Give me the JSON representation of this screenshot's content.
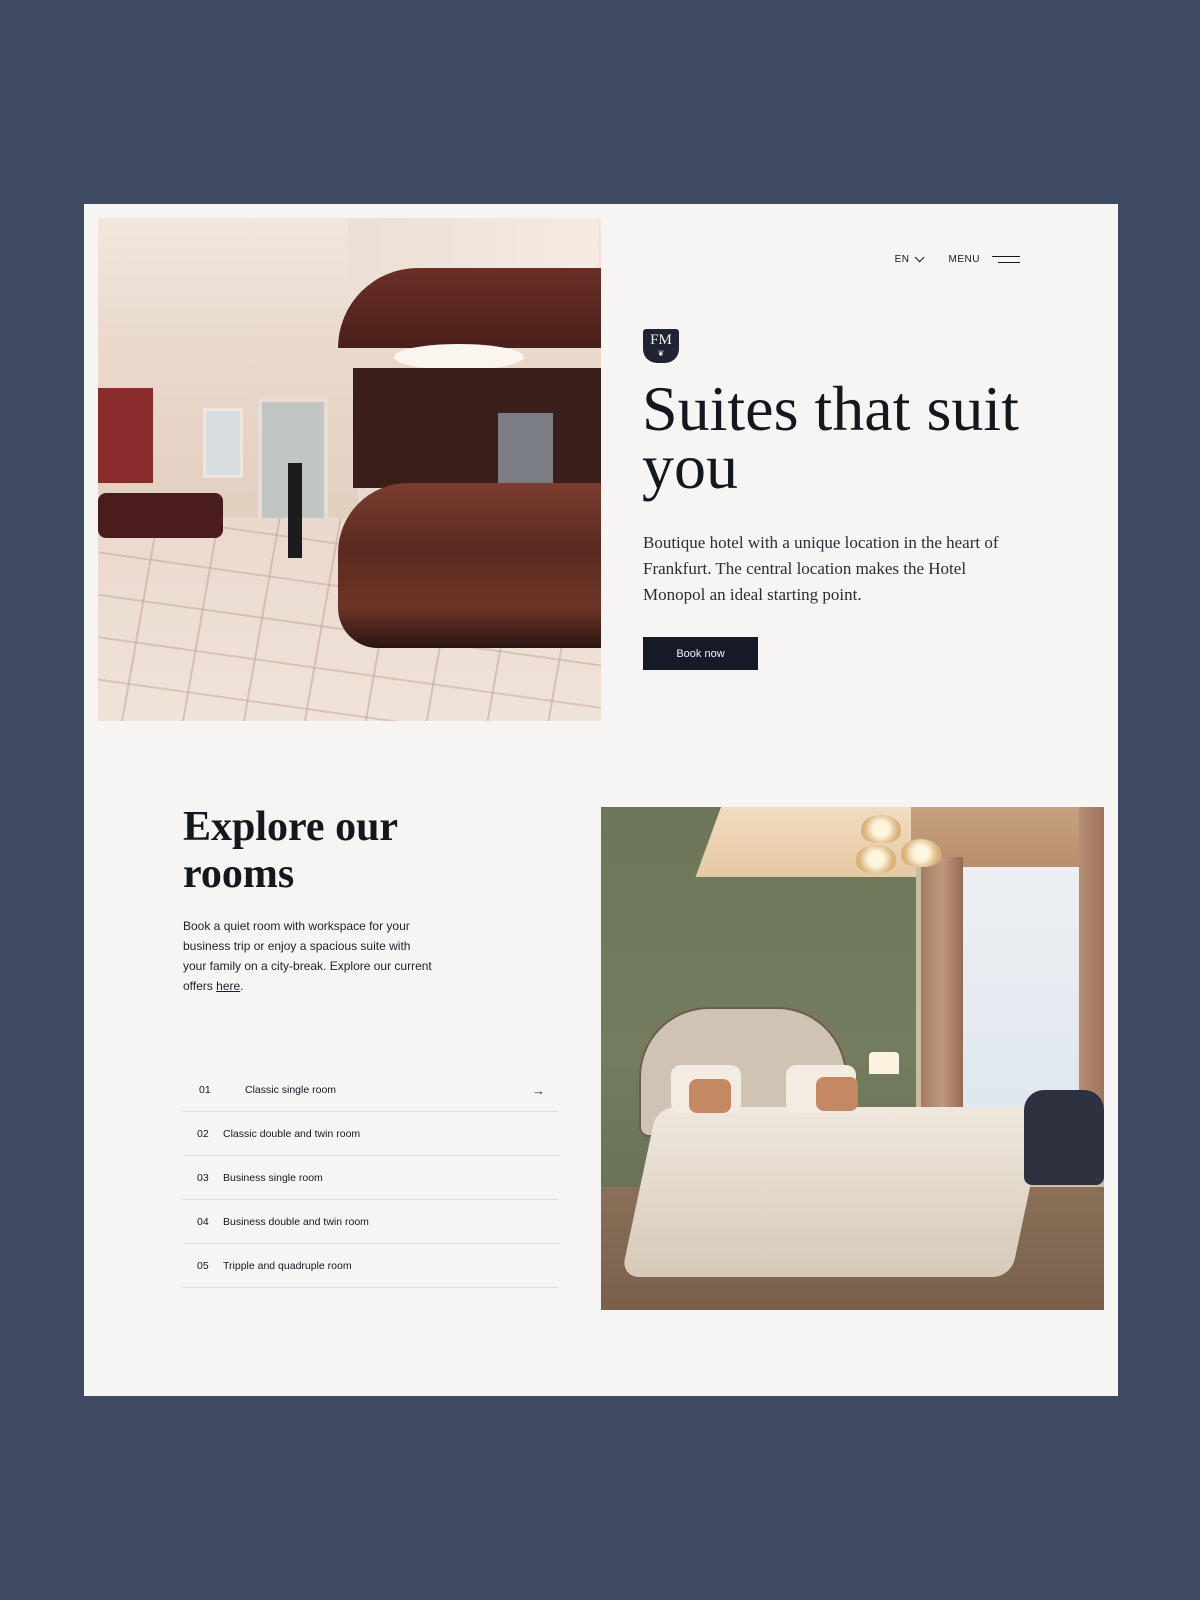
{
  "nav": {
    "language": "EN",
    "menu_label": "MENU"
  },
  "logo": {
    "monogram": "FM",
    "flourish": "❦"
  },
  "hero": {
    "title": "Suites that suit you",
    "description": "Boutique hotel with a unique location in the heart of Frankfurt.  The central location makes the Hotel Monopol an ideal starting point.",
    "button_label": "Book now"
  },
  "rooms": {
    "title": "Explore our rooms",
    "description_before_link": "Book a quiet room with workspace for your business trip or enjoy a spacious suite with your family on a city-break. Explore our current offers ",
    "link_text": "here",
    "description_after_link": ".",
    "items": [
      {
        "number": "01",
        "label": "Classic single room"
      },
      {
        "number": "02",
        "label": "Classic double and twin room"
      },
      {
        "number": "03",
        "label": "Business single room"
      },
      {
        "number": "04",
        "label": "Business double and twin room"
      },
      {
        "number": "05",
        "label": "Tripple and quadruple room"
      }
    ],
    "active_item_arrow": "→"
  },
  "colors": {
    "background": "#3e4a60",
    "page": "#f6f5f3",
    "button": "#161a26",
    "text": "#15171f"
  }
}
